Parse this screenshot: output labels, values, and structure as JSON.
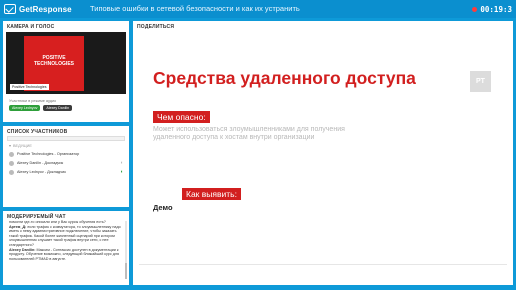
{
  "app": {
    "logo_text": "GetResponse",
    "title": "Типовые ошибки в сетевой безопасности и как их устранить",
    "timer": "00:19:3",
    "timer_status_color": "#ff3b3b",
    "accent_color": "#0e9ad8"
  },
  "camera": {
    "title": "КАМЕРА И ГОЛОС",
    "slide_text": "POSITIVE TECHNOLOGIES",
    "caption": "Positive Technologies",
    "participants_note": "Участники в режиме аудио",
    "audio_participants": [
      "Alexey Lednyov",
      "Alexey Danilin"
    ]
  },
  "participants": {
    "title": "СПИСОК УЧАСТНИКОВ",
    "group_label": "ВЕДУЩИЕ",
    "items": [
      {
        "name": "Positive Technologies - Организатор",
        "mic": "off"
      },
      {
        "name": "Alexey Danilin - Докладчик",
        "mic": "off"
      },
      {
        "name": "Alexey Lednyov - Докладчик",
        "mic": "on"
      }
    ]
  },
  "chat": {
    "title": "МОДЕРИРУЕМЫЙ ЧАТ",
    "messages": [
      {
        "author": "",
        "text": "помогли где-то описали или у Вас курсы обучения есть?"
      },
      {
        "author": "Артем_Д:",
        "text": "если трафик с коммутатора, то злоумышленнику надо иметь к нему административное подключение, чтобы заказать такой трафик. Какой более жизненный сценарий при котором злоумышленник слушает такой трафик внутри сети, с нее стандартного?"
      },
      {
        "author": "Alexey Danilin:",
        "text": "Максим - Синтаксис доступен в документации к продукту. Обучение возможно, следующий ближайший курс для пользователей PTMAD в августе."
      }
    ]
  },
  "share": {
    "title": "ПОДЕЛИТЬСЯ",
    "heading": "Средства удаленного доступа",
    "logo_badge": "PT",
    "tag1": "Чем опасно:",
    "danger_text": "Может использоваться злоумышленниками для получения удаленного доступа к хостам внутри организации",
    "tag2": "Как выявить:",
    "detect_text": "Демо"
  }
}
